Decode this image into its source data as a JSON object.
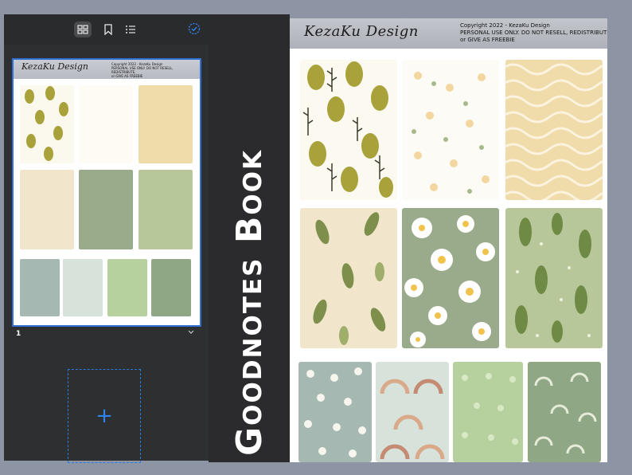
{
  "sidebar": {
    "toolbar": {
      "grid_icon": "thumbnails-grid-icon",
      "bookmark_icon": "bookmark-icon",
      "outline_icon": "outline-list-icon",
      "select_icon": "select-check-icon"
    },
    "page_number": "1",
    "add_page_symbol": "+"
  },
  "title": "Goodnotes Book",
  "page": {
    "logo": "KezaKu Design",
    "copyright_lines": [
      "Copyright 2022 - KezaKu Design",
      "PERSONAL USE ONLY. DO NOT RESELL, REDISTRIBUTE,",
      "or GIVE AS FREEBIE"
    ],
    "thumb_copyright": "Copyright 2022 - KezaKu Design\nPERSONAL USE ONLY. DO NOT RESELL, REDISTRIBUTE,\nor GIVE AS FREEBIE"
  },
  "colors": {
    "accent_blue": "#2f6fd6",
    "olive": "#a9a23a",
    "cream": "#f0dca8",
    "sage": "#9aab8b",
    "leaf_green": "#b8c79a"
  }
}
